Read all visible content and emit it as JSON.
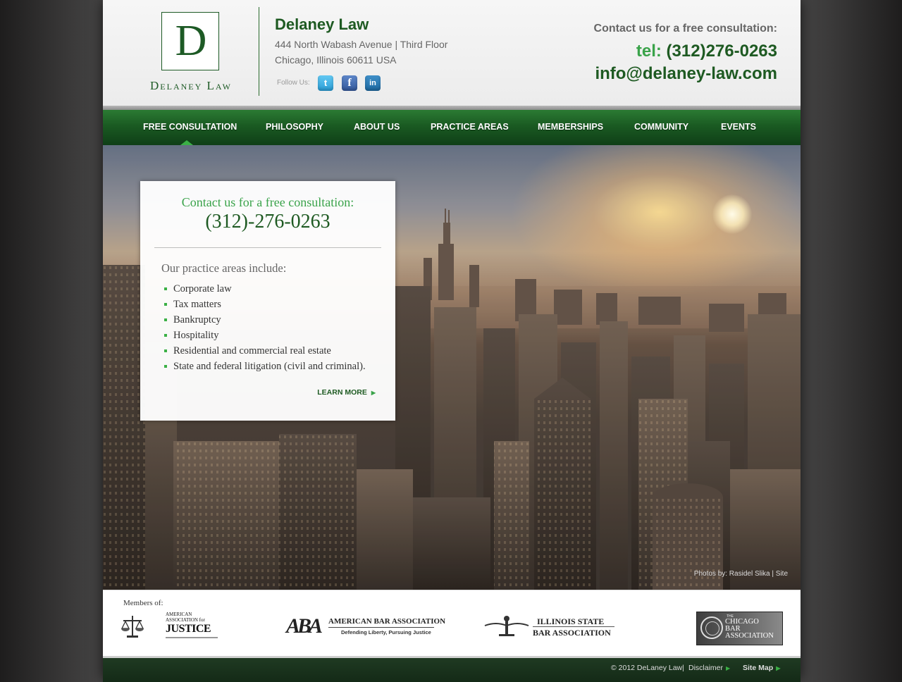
{
  "header": {
    "logo_letter": "D",
    "logo_wordmark": "Delaney Law",
    "firm_name": "Delaney Law",
    "address_line1": "444 North Wabash Avenue | Third Floor",
    "address_line2": "Chicago, Illinois 60611 USA",
    "follow_label": "Follow Us:",
    "social": [
      "twitter-icon",
      "facebook-icon",
      "linkedin-icon"
    ],
    "contact_label": "Contact us for a free consultation:",
    "tel_prefix": "tel:",
    "tel_number": "(312)276-0263",
    "email": "info@delaney-law.com"
  },
  "nav": {
    "items": [
      "FREE CONSULTATION",
      "PHILOSOPHY",
      "ABOUT US",
      "PRACTICE AREAS",
      "MEMBERSHIPS",
      "COMMUNITY",
      "EVENTS"
    ],
    "active": "FREE CONSULTATION"
  },
  "hero": {
    "cta": "Contact us for a free consultation:",
    "phone": "(312)-276-0263",
    "practice_heading": "Our practice areas include:",
    "practice_areas": [
      "Corporate law",
      "Tax matters",
      "Bankruptcy",
      "Hospitality",
      "Residential and commercial real estate",
      "State and federal litigation (civil and criminal)."
    ],
    "learn_more": "LEARN MORE",
    "photo_credit": "Photos by: Rasidel Slika | Site"
  },
  "members": {
    "label": "Members of:",
    "aaj_line1": "AMERICAN",
    "aaj_line2": "ASSOCIATION for",
    "aaj_line3": "JUSTICE",
    "aba_mark": "ABA",
    "aba_name": "AMERICAN BAR ASSOCIATION",
    "aba_tagline": "Defending Liberty, Pursuing Justice",
    "isba_line1": "ILLINOIS STATE",
    "isba_line2": "BAR ASSOCIATION",
    "cba_the": "THE",
    "cba_line1": "CHICAGO",
    "cba_line2": "BAR",
    "cba_line3": "ASSOCIATION"
  },
  "footer": {
    "copyright": "© 2012 DeLaney Law",
    "separator": "|",
    "disclaimer": "Disclaimer",
    "sitemap": "Site Map"
  },
  "colors": {
    "brand_green": "#1e5a22",
    "accent_green": "#3aa34a",
    "nav_green": "#1a5a22"
  }
}
